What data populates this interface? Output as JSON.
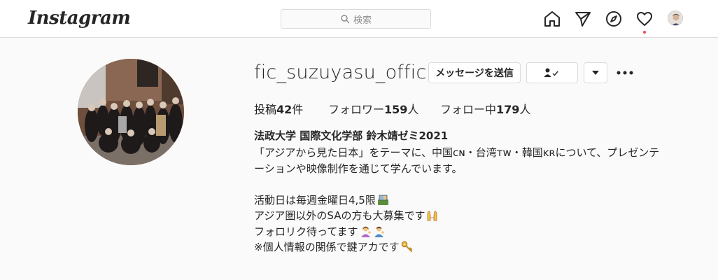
{
  "header": {
    "logo": "Instagram",
    "search_placeholder": "検索",
    "icons": [
      "home-icon",
      "direct-icon",
      "explore-icon",
      "activity-heart-icon",
      "profile-avatar"
    ],
    "notification_dot_color": "#ed4956"
  },
  "profile": {
    "username": "fic_suzuyasu_official",
    "message_button": "メッセージを送信",
    "posts": {
      "label": "投稿",
      "count": "42",
      "unit": "件"
    },
    "followers": {
      "label": "フォロワー",
      "count": "159",
      "unit": "人"
    },
    "following": {
      "label": "フォロー中",
      "count": "179",
      "unit": "人"
    },
    "full_name": "法政大学 国際文化学部 鈴木靖ゼミ2021",
    "bio_lines": [
      "「アジアから見た日本」をテーマに、中国ᴄɴ・台湾ᴛᴡ・韓国ᴋʀについて、プレゼンテ",
      "ーションや映像制作を通じて学んでいます。",
      "",
      "活動日は毎週金曜日4,5限",
      "アジア圏以外のSAの方も大募集です",
      "フォロリク待ってます",
      "※個人情報の関係で鍵アカです"
    ]
  }
}
